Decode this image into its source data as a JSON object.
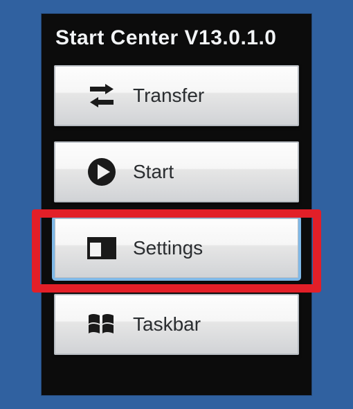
{
  "panel": {
    "title": "Start Center V13.0.1.0"
  },
  "buttons": {
    "transfer": {
      "label": "Transfer"
    },
    "start": {
      "label": "Start"
    },
    "settings": {
      "label": "Settings"
    },
    "taskbar": {
      "label": "Taskbar"
    }
  },
  "highlight": {
    "target": "settings-button"
  }
}
